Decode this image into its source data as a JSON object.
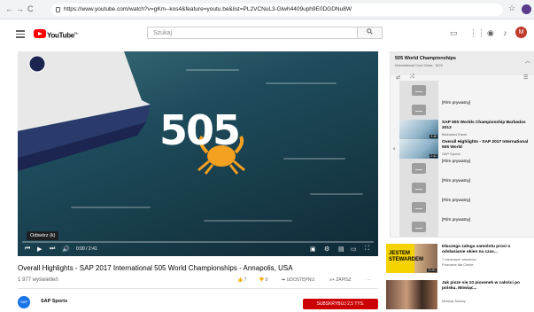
{
  "browser": {
    "url": "https://www.youtube.com/watch?v=gKm--kos4&feature=youtu.be&list=PL2VCNuL3-Glwh4409uph9E0DGDNu8W",
    "nav_back": "←",
    "nav_forward": "→",
    "nav_reload": "C",
    "star": "☆"
  },
  "header": {
    "logo_text": "YouTube",
    "logo_sup": "PL",
    "search_placeholder": "Szukaj",
    "search_icon": "search-icon",
    "avatar_letter": "M"
  },
  "player": {
    "tooltip": "Odtwórz (k)",
    "time": "0:00 / 2:41",
    "progress": 0.0,
    "overlay_text": "505",
    "colors": {
      "water": "#1e4c5c",
      "crab": "#f4a020",
      "progress": "#ff0000"
    }
  },
  "video": {
    "title": "Overall Highlights - SAP 2017 International 505 World Championships - Annapolis, USA",
    "views": "1 977 wyświetleń",
    "likes": "7",
    "dislikes": "0",
    "share": "UDOSTĘPNIJ",
    "save": "ZAPISZ",
    "more": "···"
  },
  "channel": {
    "name": "SAP Sports",
    "avatar_text": "SAP",
    "subscribe_label": "SUBSKRYBUJ  2,5 TYS."
  },
  "playlist": {
    "title": "505 World Championships",
    "subtitle": "International Cool Class · 8/22",
    "items": [
      {
        "index": "",
        "title": "",
        "channel": "",
        "duration": "",
        "type": "private"
      },
      {
        "index": "",
        "title": "[Film prywatny]",
        "channel": "",
        "duration": "",
        "type": "private"
      },
      {
        "index": "",
        "title": "SAP 505 Worlds Championship Barbados 2013",
        "channel": "BarbadosTravel",
        "duration": "3:48",
        "type": "photo"
      },
      {
        "index": "8",
        "title": "Overall Highlights - SAP 2017 International 505 World",
        "channel": "SAP Sports",
        "duration": "2:41",
        "type": "photo"
      },
      {
        "index": "",
        "title": "[Film prywatny]",
        "channel": "",
        "duration": "",
        "type": "private"
      },
      {
        "index": "",
        "title": "[Film prywatny]",
        "channel": "",
        "duration": "",
        "type": "private"
      },
      {
        "index": "",
        "title": "[Film prywatny]",
        "channel": "",
        "duration": "",
        "type": "private"
      },
      {
        "index": "",
        "title": "[Film prywatny]",
        "channel": "",
        "duration": "",
        "type": "private"
      }
    ]
  },
  "recommendations": [
    {
      "title": "Dlaczego załoga samolotu prosi o odsłanianie okien na czas...",
      "meta1": "7 minionych sekretów",
      "meta2": "Polecane dla Ciebie",
      "duration": "21:51",
      "thumb_text": "JESTEM STEWARDEM"
    },
    {
      "title": "Jak pisze się 10 piosenek w całości po polsku. Mówiąc...",
      "meta1": "Mówiąc Nazwy",
      "meta2": "",
      "duration": "",
      "thumb_text": ""
    }
  ]
}
